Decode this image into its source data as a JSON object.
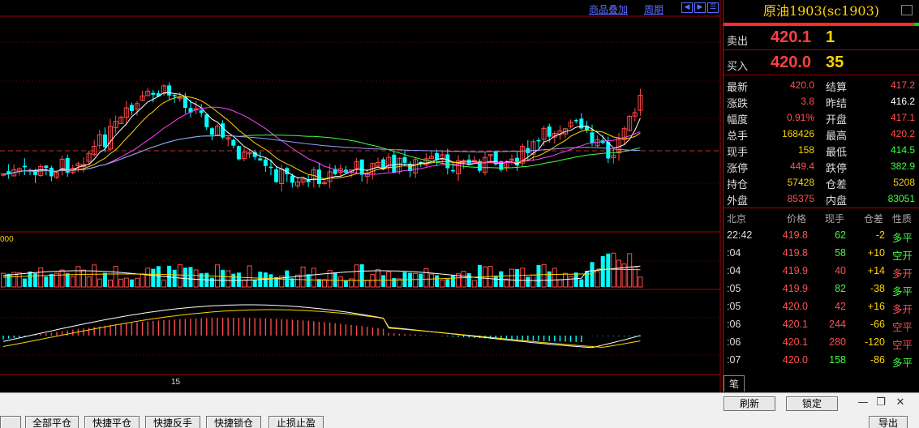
{
  "chart": {
    "links": {
      "overlay": "商品叠加",
      "period": "周期"
    },
    "volume_label": "000",
    "date_label": "15",
    "colors": {
      "up": "#ff4a4a",
      "down": "#00ffff",
      "ma5": "#ffffff",
      "ma10": "#ffd400",
      "ma20": "#ff40ff",
      "ma60": "#40ff40",
      "ma120": "#9a9aff"
    },
    "chart_data": {
      "type": "candlestick",
      "last_close": 420.1,
      "candles": []
    }
  },
  "quote": {
    "title": "原油1903(sc1903)",
    "ask": {
      "label": "卖出",
      "price": "420.1",
      "vol": "1"
    },
    "bid": {
      "label": "买入",
      "price": "420.0",
      "vol": "35"
    },
    "stats": [
      {
        "l1": "最新",
        "v1": "420.0",
        "c1": "#ff5050",
        "l2": "结算",
        "v2": "417.2",
        "c2": "#ff5050"
      },
      {
        "l1": "涨跌",
        "v1": "3.8",
        "c1": "#ff5050",
        "l2": "昨结",
        "v2": "416.2",
        "c2": "#ffffff"
      },
      {
        "l1": "幅度",
        "v1": "0.91%",
        "c1": "#ff5050",
        "l2": "开盘",
        "v2": "417.1",
        "c2": "#ff5050"
      },
      {
        "l1": "总手",
        "v1": "168426",
        "c1": "#ffd400",
        "l2": "最高",
        "v2": "420.2",
        "c2": "#ff5050"
      },
      {
        "l1": "现手",
        "v1": "158",
        "c1": "#ffd400",
        "l2": "最低",
        "v2": "414.5",
        "c2": "#40ff40"
      },
      {
        "l1": "涨停",
        "v1": "449.4",
        "c1": "#ff5050",
        "l2": "跌停",
        "v2": "382.9",
        "c2": "#40ff40"
      },
      {
        "l1": "持仓",
        "v1": "57428",
        "c1": "#ffd400",
        "l2": "仓差",
        "v2": "5208",
        "c2": "#ffd400"
      },
      {
        "l1": "外盘",
        "v1": "85375",
        "c1": "#ff5050",
        "l2": "内盘",
        "v2": "83051",
        "c2": "#40ff40"
      }
    ],
    "ticks_header": {
      "time": "北京",
      "price": "价格",
      "vol": "现手",
      "chg": "仓差",
      "nature": "性质"
    },
    "ticks": [
      {
        "time": "22:42",
        "price": "419.8",
        "vol": "62",
        "vc": "#40ff40",
        "chg": "-2",
        "cc": "#ffd400",
        "nature": "多平",
        "nc": "#40ff40"
      },
      {
        "time": ":04",
        "price": "419.8",
        "vol": "58",
        "vc": "#40ff40",
        "chg": "+10",
        "cc": "#ffd400",
        "nature": "空开",
        "nc": "#40ff40"
      },
      {
        "time": ":04",
        "price": "419.9",
        "vol": "40",
        "vc": "#ff5050",
        "chg": "+14",
        "cc": "#ffd400",
        "nature": "多开",
        "nc": "#ff5050"
      },
      {
        "time": ":05",
        "price": "419.9",
        "vol": "82",
        "vc": "#40ff40",
        "chg": "-38",
        "cc": "#ffd400",
        "nature": "多平",
        "nc": "#40ff40"
      },
      {
        "time": ":05",
        "price": "420.0",
        "vol": "42",
        "vc": "#ff5050",
        "chg": "+16",
        "cc": "#ffd400",
        "nature": "多开",
        "nc": "#ff5050"
      },
      {
        "time": ":06",
        "price": "420.1",
        "vol": "244",
        "vc": "#ff5050",
        "chg": "-66",
        "cc": "#ffd400",
        "nature": "空平",
        "nc": "#ff5050"
      },
      {
        "time": ":06",
        "price": "420.1",
        "vol": "280",
        "vc": "#ff5050",
        "chg": "-120",
        "cc": "#ffd400",
        "nature": "空平",
        "nc": "#ff5050"
      },
      {
        "time": ":07",
        "price": "420.0",
        "vol": "158",
        "vc": "#40ff40",
        "chg": "-86",
        "cc": "#ffd400",
        "nature": "多平",
        "nc": "#40ff40"
      }
    ],
    "tab_label": "笔"
  },
  "toolbar": {
    "close_all": "全部平仓",
    "quick_close": "快捷平仓",
    "quick_reverse": "快捷反手",
    "quick_lock": "快捷锁仓",
    "stop": "止损止盈",
    "refresh": "刷新",
    "lock": "锁定",
    "export": "导出"
  }
}
